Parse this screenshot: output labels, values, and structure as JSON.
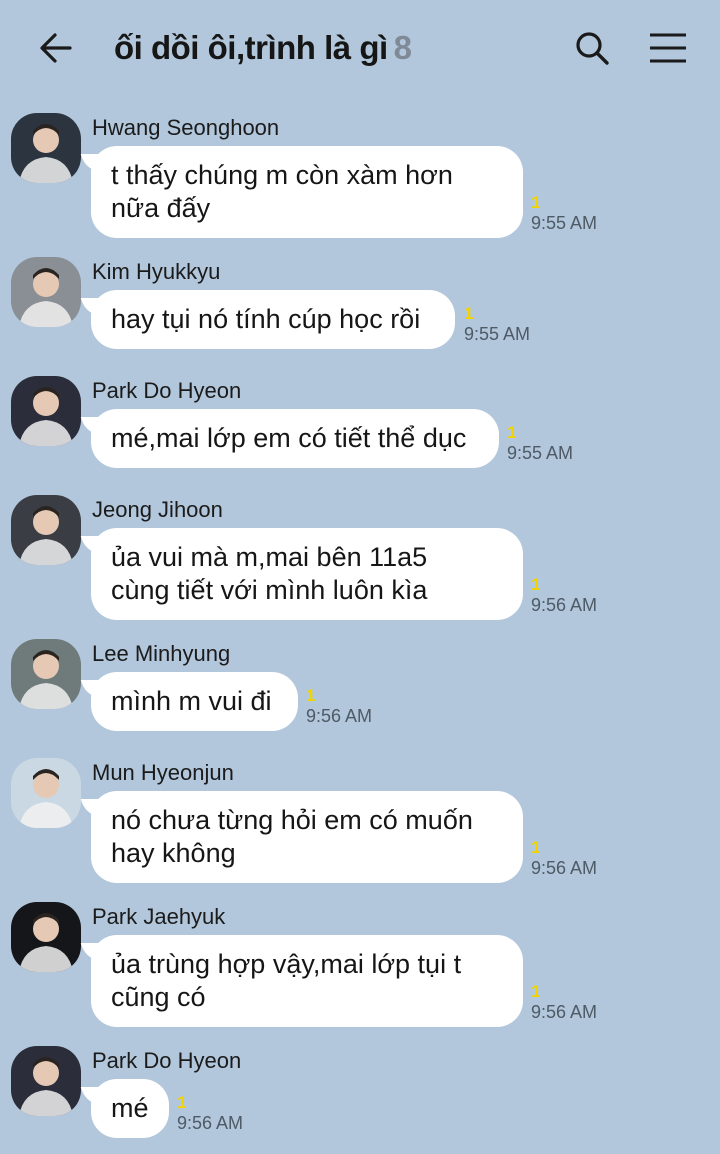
{
  "header": {
    "title": "ối dồi ôi,trình là gì",
    "member_count": "8"
  },
  "messages": [
    {
      "sender": "Hwang Seonghoon",
      "lines": [
        "t thấy chúng m còn xàm hơn",
        "nữa đấy"
      ],
      "unread": "1",
      "time": "9:55 AM",
      "avatar_bg": "#2c3440"
    },
    {
      "sender": "Kim Hyukkyu",
      "lines": [
        "hay tụi nó tính cúp học rồi"
      ],
      "unread": "1",
      "time": "9:55 AM",
      "avatar_bg": "#8a8f96"
    },
    {
      "sender": "Park Do Hyeon",
      "lines": [
        "mé,mai lớp em có tiết thể dục"
      ],
      "unread": "1",
      "time": "9:55 AM",
      "avatar_bg": "#2b2d3a"
    },
    {
      "sender": "Jeong Jihoon",
      "lines": [
        "ủa vui mà m,mai bên 11a5",
        "cùng tiết với mình luôn kìa"
      ],
      "unread": "1",
      "time": "9:56 AM",
      "avatar_bg": "#3a3d44"
    },
    {
      "sender": "Lee Minhyung",
      "lines": [
        "mình m vui đi"
      ],
      "unread": "1",
      "time": "9:56 AM",
      "avatar_bg": "#6f7b7a"
    },
    {
      "sender": "Mun Hyeonjun",
      "lines": [
        "nó chưa từng hỏi em có muốn",
        "hay không"
      ],
      "unread": "1",
      "time": "9:56 AM",
      "avatar_bg": "#c9d8e2"
    },
    {
      "sender": "Park Jaehyuk",
      "lines": [
        "ủa trùng hợp vậy,mai lớp tụi t",
        "cũng có"
      ],
      "unread": "1",
      "time": "9:56 AM",
      "avatar_bg": "#15161a"
    },
    {
      "sender": "Park Do Hyeon",
      "lines": [
        "mé"
      ],
      "unread": "1",
      "time": "9:56 AM",
      "avatar_bg": "#2b2d3a"
    }
  ]
}
